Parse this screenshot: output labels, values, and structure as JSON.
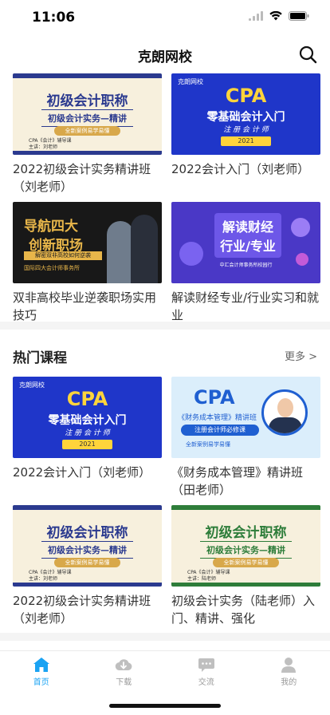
{
  "status": {
    "time": "11:06"
  },
  "nav": {
    "title": "克朗网校"
  },
  "top_courses": [
    {
      "title": "2022初级会计实务精讲班（刘老师）",
      "thumb": {
        "big": "初级会计职称",
        "mid": "初级会计实务—精讲",
        "pill": "全新案例易学易懂",
        "small1": "CPA《会计》辅导课",
        "small2": "主讲：刘老师"
      }
    },
    {
      "title": "2022会计入门（刘老师）",
      "thumb": {
        "logo": "克朗网校",
        "cpa": "CPA",
        "line1": "零基础会计入门",
        "line2": "注 册 会 计 师",
        "year": "2021"
      }
    },
    {
      "title": "双非高校毕业逆袭职场实用技巧",
      "thumb": {
        "t1": "导航四大",
        "t2": "创新职场",
        "bar": "解密双非高校如何逆袭",
        "t3": "国际四大会计师事务所"
      }
    },
    {
      "title": "解读财经专业/行业实习和就业",
      "thumb": {
        "l1": "解读财经",
        "l2": "行业/专业",
        "sub": "中汇会计师事务所校园行"
      }
    }
  ],
  "hot_section": {
    "title": "热门课程",
    "more": "更多 >"
  },
  "hot_courses": [
    {
      "title": "2022会计入门（刘老师）",
      "thumb": {
        "logo": "克朗网校",
        "cpa": "CPA",
        "line1": "零基础会计入门",
        "line2": "注 册 会 计 师",
        "year": "2021"
      }
    },
    {
      "title": "《财务成本管理》精讲班（田老师）",
      "thumb": {
        "cpa": "CPA",
        "l1": "《财务成本管理》精讲班",
        "btn": "注册会计师必修课",
        "l2": "全新案例易学易懂"
      }
    },
    {
      "title": "2022初级会计实务精讲班（刘老师）",
      "thumb": {
        "big": "初级会计职称",
        "mid": "初级会计实务—精讲",
        "pill": "全新案例易学易懂",
        "small1": "CPA《会计》辅导课",
        "small2": "主讲：刘老师"
      }
    },
    {
      "title": "初级会计实务（陆老师）入门、精讲、强化",
      "thumb": {
        "big": "初级会计职称",
        "mid": "初级会计实务—精讲",
        "pill": "全新案例易学易懂",
        "small1": "CPA《会计》辅导课",
        "small2": "主讲：陆老师"
      }
    }
  ],
  "tabs": [
    {
      "label": "首页",
      "icon": "home-icon",
      "active": true
    },
    {
      "label": "下载",
      "icon": "download-icon",
      "active": false
    },
    {
      "label": "交流",
      "icon": "chat-icon",
      "active": false
    },
    {
      "label": "我的",
      "icon": "profile-icon",
      "active": false
    }
  ],
  "colors": {
    "accent": "#1aa3f3",
    "inactive": "#bfbfbf"
  }
}
